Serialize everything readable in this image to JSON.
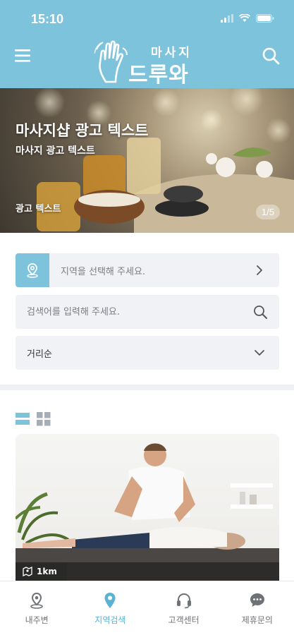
{
  "status_bar": {
    "time": "15:10"
  },
  "header": {
    "logo_top": "마사지",
    "logo_main": "드루와"
  },
  "banner": {
    "title": "마사지샵 광고 텍스트",
    "subtitle": "마사지 광고 텍스트",
    "tag": "광고 텍스트",
    "page_indicator": "1/5"
  },
  "filters": {
    "region_placeholder": "지역을 선택해 주세요.",
    "search_placeholder": "검색어를 입력해 주세요.",
    "sort_value": "거리순"
  },
  "list": {
    "items": [
      {
        "distance": "1km"
      }
    ]
  },
  "bottom_nav": {
    "items": [
      {
        "label": "내주변",
        "icon": "location-pin-icon",
        "active": false
      },
      {
        "label": "지역검색",
        "icon": "map-pin-icon",
        "active": true
      },
      {
        "label": "고객센터",
        "icon": "headset-icon",
        "active": false
      },
      {
        "label": "제휴문의",
        "icon": "chat-bubble-icon",
        "active": false
      }
    ]
  },
  "colors": {
    "brand": "#7ec3dc",
    "active_nav": "#5bb2d4",
    "field_bg": "#f0f2f5"
  }
}
